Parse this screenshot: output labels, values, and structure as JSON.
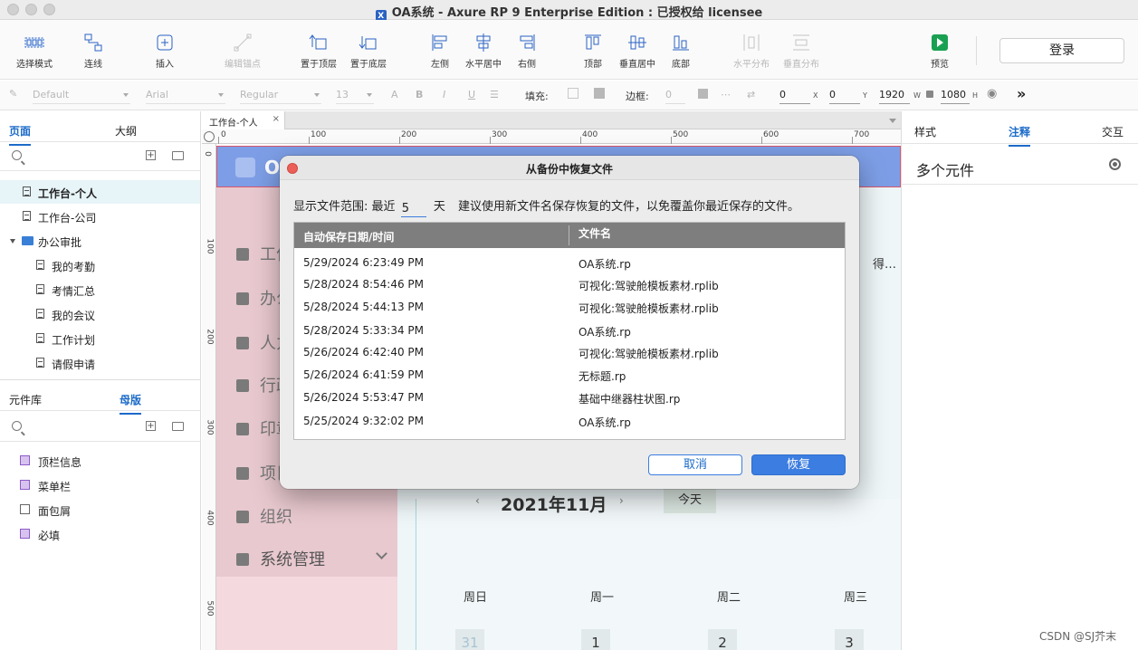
{
  "window": {
    "title": "OA系统 - Axure RP 9 Enterprise Edition : 已授权给 licensee",
    "app_icon": "X"
  },
  "toolbar": {
    "tools": [
      {
        "id": "select-mode",
        "label": "选择模式",
        "icon": "select-mode-icon",
        "enabled": true
      },
      {
        "id": "connector",
        "label": "连线",
        "icon": "connector-icon",
        "enabled": true
      },
      {
        "id": "insert",
        "label": "插入",
        "icon": "insert-icon",
        "enabled": true
      },
      {
        "id": "edit-points",
        "label": "编辑锚点",
        "icon": "edit-points-icon",
        "enabled": false
      },
      {
        "id": "bring-front",
        "label": "置于顶层",
        "icon": "bring-to-front-icon",
        "enabled": true
      },
      {
        "id": "send-back",
        "label": "置于底层",
        "icon": "send-to-back-icon",
        "enabled": true
      },
      {
        "id": "align-left",
        "label": "左侧",
        "icon": "align-left-icon",
        "enabled": true
      },
      {
        "id": "align-hcenter",
        "label": "水平居中",
        "icon": "align-center-icon",
        "enabled": true
      },
      {
        "id": "align-right",
        "label": "右侧",
        "icon": "align-right-icon",
        "enabled": true
      },
      {
        "id": "align-top",
        "label": "顶部",
        "icon": "align-top-icon",
        "enabled": true
      },
      {
        "id": "align-vcenter",
        "label": "垂直居中",
        "icon": "align-middle-icon",
        "enabled": true
      },
      {
        "id": "align-bottom",
        "label": "底部",
        "icon": "align-bottom-icon",
        "enabled": true
      },
      {
        "id": "dist-h",
        "label": "水平分布",
        "icon": "distribute-h-icon",
        "enabled": false
      },
      {
        "id": "dist-v",
        "label": "垂直分布",
        "icon": "distribute-v-icon",
        "enabled": false
      },
      {
        "id": "preview",
        "label": "预览",
        "icon": "preview-icon",
        "enabled": true
      }
    ],
    "login_label": "登录"
  },
  "formatbar": {
    "style": "Default",
    "font": "Arial",
    "weight": "Regular",
    "size": "13",
    "fill_label": "填充:",
    "border_label": "边框:",
    "border_value": "0",
    "x": "0",
    "y": "0",
    "w": "1920",
    "h": "1080",
    "x_unit": "X",
    "y_unit": "Y",
    "w_unit": "W",
    "h_unit": "H"
  },
  "leftpanel": {
    "tabs": [
      "页面",
      "大纲"
    ],
    "pages": [
      {
        "label": "工作台-个人",
        "level": 0,
        "selected": true
      },
      {
        "label": "工作台-公司",
        "level": 0
      },
      {
        "label": "办公审批",
        "level": 0,
        "folder": true
      },
      {
        "label": "我的考勤",
        "level": 1
      },
      {
        "label": "考情汇总",
        "level": 1
      },
      {
        "label": "我的会议",
        "level": 1
      },
      {
        "label": "工作计划",
        "level": 1
      },
      {
        "label": "请假申请",
        "level": 1
      }
    ],
    "lib_tabs": [
      "元件库",
      "母版"
    ],
    "masters": [
      "顶栏信息",
      "菜单栏",
      "面包屑",
      "必填"
    ]
  },
  "canvas": {
    "doc_tab": "工作台-个人",
    "ruler_h": [
      "0",
      "100",
      "200",
      "300",
      "400",
      "500",
      "600",
      "700"
    ],
    "ruler_v": [
      "0",
      "100",
      "200",
      "300",
      "400",
      "500"
    ],
    "design": {
      "logo_text": "OA",
      "menu": [
        "工作",
        "办公",
        "人力",
        "行政",
        "印章",
        "项目",
        "组织",
        "系统管理"
      ],
      "ellipsis": "得…",
      "month_prev": "‹",
      "month_next": "›",
      "month": "2021年11月",
      "today": "今天",
      "weekdays": [
        "周日",
        "周一",
        "周二",
        "周三"
      ],
      "days": [
        "31",
        "1",
        "2",
        "3"
      ]
    }
  },
  "rightpanel": {
    "tabs": [
      "样式",
      "注释",
      "交互"
    ],
    "heading": "多个元件"
  },
  "dialog": {
    "title": "从备份中恢复文件",
    "range_label": "显示文件范围:",
    "range_prefix": "最近",
    "range_value": "5",
    "range_unit": "天",
    "hint": "建议使用新文件名保存恢复的文件，以免覆盖你最近保存的文件。",
    "columns": [
      "自动保存日期/时间",
      "文件名"
    ],
    "rows": [
      [
        "5/29/2024 6:23:49 PM",
        "OA系统.rp"
      ],
      [
        "5/28/2024 8:54:46 PM",
        "可视化:驾驶舱模板素材.rplib"
      ],
      [
        "5/28/2024 5:44:13 PM",
        "可视化:驾驶舱模板素材.rplib"
      ],
      [
        "5/28/2024 5:33:34 PM",
        "OA系统.rp"
      ],
      [
        "5/26/2024 6:42:40 PM",
        "可视化:驾驶舱模板素材.rplib"
      ],
      [
        "5/26/2024 6:41:59 PM",
        "无标题.rp"
      ],
      [
        "5/26/2024 5:53:47 PM",
        "基础中继器柱状图.rp"
      ],
      [
        "5/25/2024 9:32:02 PM",
        "OA系统.rp"
      ]
    ],
    "cancel_label": "取消",
    "ok_label": "恢复"
  },
  "watermark": "CSDN @SJ芥末",
  "colors": {
    "accent": "#3b7de0",
    "header": "#7d9ee6",
    "sidebar": "#e8c9cf",
    "close": "#ec5f58"
  }
}
